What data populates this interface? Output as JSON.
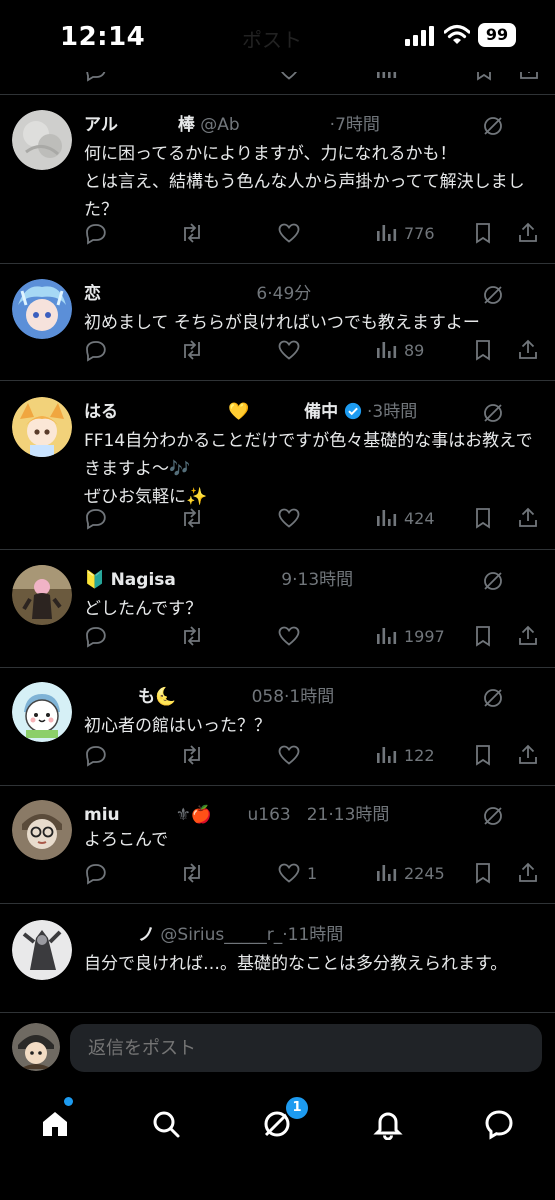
{
  "status_bar": {
    "time": "12:14",
    "battery": "99",
    "faded_title": "ポスト"
  },
  "replies": [
    {
      "name": "アル",
      "name_tail": "棒",
      "handle": "@Ab",
      "time": "·7時間",
      "text": "何に困ってるかによりますが、力になれるかも！\nとは言え、結構もう色んな人から声掛かってて解決しました？",
      "views": "776",
      "likes": ""
    },
    {
      "name": "恋",
      "name_tail": "",
      "handle": "",
      "time": "6·49分",
      "text": "初めまして そちらが良ければいつでも教えますよー",
      "views": "89",
      "likes": ""
    },
    {
      "name": "はる",
      "name_tail": "備中",
      "handle": "",
      "time": "·3時間",
      "text": "FF14自分わかることだけですが色々基礎的な事はお教えできますよ〜🎶\nぜひお気軽に✨",
      "views": "424",
      "likes": ""
    },
    {
      "name": "Nagisa",
      "name_tail": "",
      "handle": "",
      "time": "9·13時間",
      "text": "どしたんです？",
      "views": "1997",
      "likes": ""
    },
    {
      "name": "も",
      "name_tail": "",
      "handle": "058",
      "time": "·1時間",
      "text": "初心者の館はいった？？",
      "views": "122",
      "likes": ""
    },
    {
      "name": "miu",
      "name_tail": "⚜🍎",
      "handle": "u163",
      "time": "21·13時間",
      "text": "よろこんで",
      "views": "2245",
      "likes": "1"
    },
    {
      "name": "ノ",
      "name_tail": "",
      "handle": "@Sirius_____r_",
      "time": "·11時間",
      "text": "自分で良ければ…。基礎的なことは多分教えられます。",
      "views": "",
      "likes": ""
    }
  ],
  "reply_bar": {
    "placeholder": "返信をポスト"
  },
  "tab_bar": {
    "messages_badge": "1"
  },
  "colors": {
    "background": "#000000",
    "text": "#e7e9ea",
    "muted": "#71767b",
    "accent": "#1d9bf0",
    "verified": "#1d9bf0"
  },
  "icons": [
    "reply-icon",
    "repost-icon",
    "like-icon",
    "views-icon",
    "bookmark-icon",
    "share-icon",
    "grok-icon",
    "home-icon",
    "search-icon",
    "grok-tab-icon",
    "bell-icon",
    "messages-icon"
  ]
}
